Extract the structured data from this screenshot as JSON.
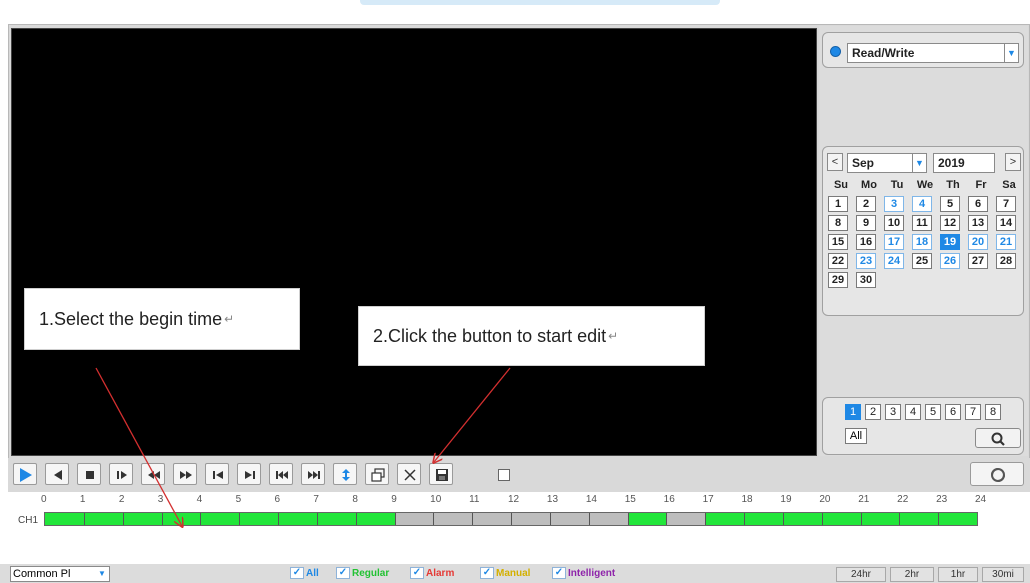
{
  "toolbar": {
    "buttons": [
      {
        "name": "play-button",
        "icon": "play-icon"
      },
      {
        "name": "reverse-play-button",
        "icon": "reverse-play-icon"
      },
      {
        "name": "stop-button",
        "icon": "stop-icon"
      },
      {
        "name": "step-forward-button",
        "icon": "step-forward-icon"
      },
      {
        "name": "slow-backward-button",
        "icon": "slow-backward-icon"
      },
      {
        "name": "fast-forward-button",
        "icon": "fast-forward-icon"
      },
      {
        "name": "previous-frame-button",
        "icon": "previous-frame-icon"
      },
      {
        "name": "next-frame-button",
        "icon": "next-frame-icon"
      },
      {
        "name": "previous-file-button",
        "icon": "previous-file-icon"
      },
      {
        "name": "next-file-button",
        "icon": "next-file-icon"
      },
      {
        "name": "sync-button",
        "icon": "sync-icon"
      },
      {
        "name": "window-button",
        "icon": "window-icon"
      },
      {
        "name": "clip-edit-button",
        "icon": "scissors-icon"
      },
      {
        "name": "save-clip-button",
        "icon": "save-icon"
      }
    ]
  },
  "side": {
    "mode": {
      "value": "Read/Write"
    },
    "calendar": {
      "prev": "<",
      "next": ">",
      "month": "Sep",
      "year": "2019",
      "weekdays": [
        "Su",
        "Mo",
        "Tu",
        "We",
        "Th",
        "Fr",
        "Sa"
      ],
      "recorded_days": [
        3,
        4,
        17,
        18,
        20,
        21,
        23,
        24,
        26
      ],
      "selected_day": 19
    },
    "channels": {
      "labels": [
        "1",
        "2",
        "3",
        "4",
        "5",
        "6",
        "7",
        "8"
      ],
      "selected": "1",
      "all_label": "All"
    }
  },
  "timeline": {
    "channel_label": "CH1",
    "hours": [
      "0",
      "1",
      "2",
      "3",
      "4",
      "5",
      "6",
      "7",
      "8",
      "9",
      "10",
      "11",
      "12",
      "13",
      "14",
      "15",
      "16",
      "17",
      "18",
      "19",
      "20",
      "21",
      "22",
      "23",
      "24"
    ],
    "recorded_ranges_hours": [
      [
        0,
        9
      ],
      [
        15,
        16
      ],
      [
        17,
        24
      ]
    ]
  },
  "bottom": {
    "playlist_select": "Common Pl",
    "filters": [
      {
        "label": "All",
        "color": "#1e88e5"
      },
      {
        "label": "Regular",
        "color": "#22c232"
      },
      {
        "label": "Alarm",
        "color": "#e53935"
      },
      {
        "label": "Manual",
        "color": "#d4b000"
      },
      {
        "label": "Intelligent",
        "color": "#8e24aa"
      }
    ],
    "zoom": [
      "24hr",
      "2hr",
      "1hr",
      "30mi"
    ]
  },
  "annotations": {
    "callout1_text": "1.Select the begin time",
    "callout2_text": "2.Click the button to start edit",
    "return_mark": "↵"
  },
  "colors": {
    "accent": "#1e88e5",
    "record_green": "#22e63a",
    "arrow": "#d32f2f"
  }
}
